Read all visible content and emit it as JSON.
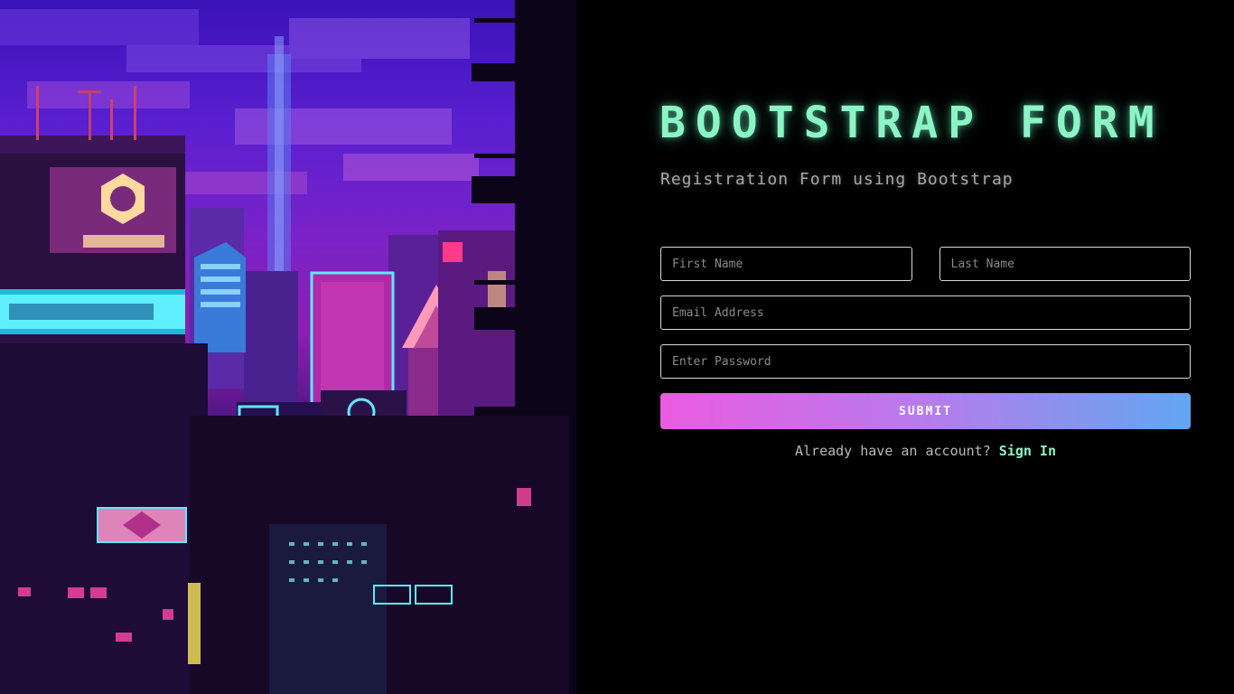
{
  "hero": {
    "title": "BOOTSTRAP FORM",
    "subtitle": "Registration Form using Bootstrap"
  },
  "form": {
    "first_name_placeholder": "First Name",
    "last_name_placeholder": "Last Name",
    "email_placeholder": "Email Address",
    "password_placeholder": "Enter Password",
    "submit_label": "SUBMIT",
    "signin_prompt": "Already have an account?",
    "signin_link": "Sign In"
  },
  "colors": {
    "accent": "#8cf5c6",
    "button_gradient_start": "#ea5ce0",
    "button_gradient_end": "#62a6f2",
    "background": "#000000"
  }
}
